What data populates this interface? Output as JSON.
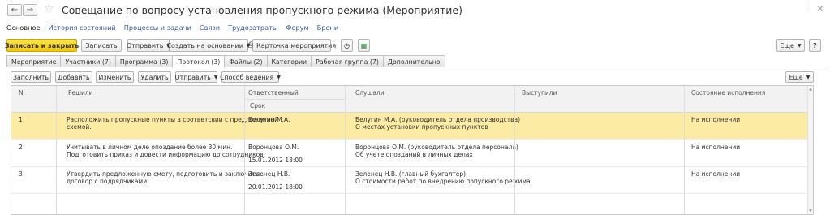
{
  "window": {
    "title": "Совещание по вопросу установления пропускного режима (Мероприятие)"
  },
  "nav": [
    "Основное",
    "История состояний",
    "Процессы и задачи",
    "Связи",
    "Трудозатраты",
    "Форум",
    "Брони"
  ],
  "toolbar": {
    "save_close": "Записать и закрыть",
    "save": "Записать",
    "send": "Отправить",
    "create_based": "Создать на основании",
    "card": "Карточка мероприятия",
    "more": "Еще"
  },
  "tabs": [
    "Мероприятие",
    "Участники (7)",
    "Программа (3)",
    "Протокол (3)",
    "Файлы (2)",
    "Категории",
    "Рабочая группа (7)",
    "Дополнительно"
  ],
  "protocol_toolbar": {
    "fill": "Заполнить",
    "add": "Добавить",
    "edit": "Изменить",
    "delete": "Удалить",
    "send": "Отправить",
    "method": "Способ ведения",
    "more": "Еще"
  },
  "table": {
    "columns": {
      "n": "N",
      "decisions": "Решили",
      "responsible": "Ответственный",
      "deadline": "Срок",
      "heard": "Слушали",
      "spoke": "Выступили",
      "status": "Состояние исполнения"
    },
    "rows": [
      {
        "n": "1",
        "decision_line1": "Расположить пропускные пункты в соответсвии с предложенной",
        "decision_line2": "схемой.",
        "responsible": "Белугин М.А.",
        "deadline": "",
        "heard_line1": "Белугин М.А. (руководитель отдела производства)",
        "heard_line2": "О местах установки пропускных пунктов",
        "spoke": "",
        "status": "На исполнении"
      },
      {
        "n": "2",
        "decision_line1": "Учитывать в личном деле опоздание более 30 мин.",
        "decision_line2": "Подготовить приказ и довести информацию до сотрудников.",
        "responsible": "Воронцова О.М.",
        "deadline": "15.01.2012 18:00",
        "heard_line1": "Воронцова О.М. (руководитель отдела персонала)",
        "heard_line2": "Об учете опозданий в личных делах",
        "spoke": "",
        "status": "На исполнении"
      },
      {
        "n": "3",
        "decision_line1": "Утвердить предложенную смету, подготовить и заключить",
        "decision_line2": "договор с подрядчиками.",
        "responsible": "Зеленец Н.В.",
        "deadline": "20.01.2012 18:00",
        "heard_line1": "Зеленец Н.В. (главный бухгалтер)",
        "heard_line2": "О стоимости работ по внедрению попускного режима",
        "spoke": "",
        "status": "На исполнении"
      }
    ]
  },
  "colors": {
    "primary_button": "#f4c800",
    "selected_row": "#fbeba3",
    "link": "#3a5ea8"
  }
}
